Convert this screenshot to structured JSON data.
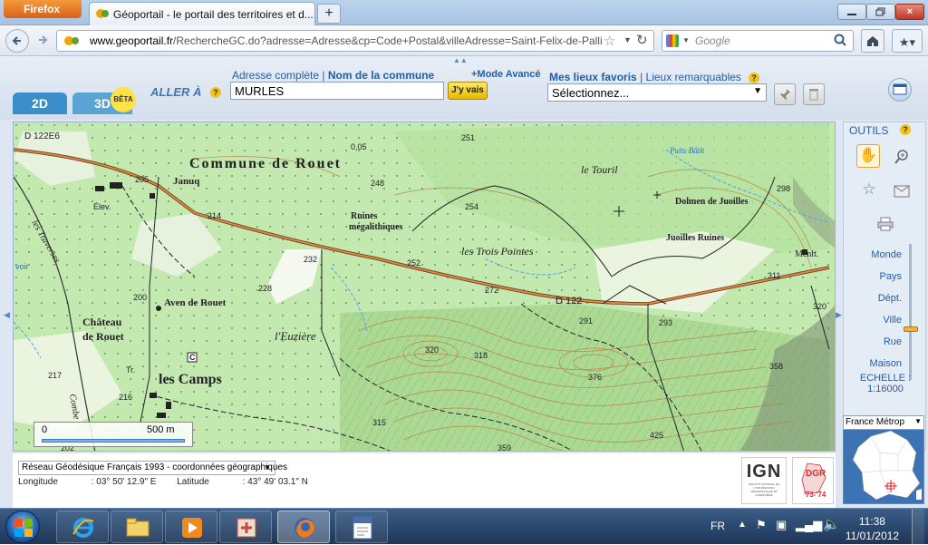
{
  "browser": {
    "app_button": "Firefox",
    "tab_title": "Géoportail - le portail des territoires et d...",
    "url_domain": "www.geoportail.fr",
    "url_path": "/RechercheGC.do?adresse=Adresse&cp=Code+Postal&villeAdresse=Saint-Felix-de-Palli",
    "search_placeholder": "Google",
    "new_tab": "+",
    "close_glyph": "×"
  },
  "geoportail": {
    "mode_tabs": [
      {
        "label": "2D"
      },
      {
        "label": "3D"
      }
    ],
    "beta_label": "BÊTA",
    "aller_a": "ALLER À",
    "help": "?",
    "address_link": "Adresse complète",
    "separator": "|",
    "commune_link": "Nom de la commune",
    "mode_avance": "+Mode Avancé",
    "address_value": "MURLES",
    "go_button": "J'y vais",
    "favoris_link": "Mes lieux favoris",
    "remarquables_link": "Lieux remarquables",
    "favoris_select": "Sélectionnez...",
    "outils_title": "OUTILS",
    "zoom_levels": [
      "Monde",
      "Pays",
      "Dépt.",
      "Ville",
      "Rue",
      "Maison"
    ],
    "zoom_level_fraction": 0.8,
    "echelle_label": "ECHELLE :",
    "echelle_value": "1:16000",
    "minimap_select": "France Métrop",
    "projection": "Réseau Géodésique Français 1993 - coordonnées géographiques",
    "longitude_label": "Longitude",
    "longitude_value": ": 03° 50' 12.9\" E",
    "latitude_label": "Latitude",
    "latitude_value": ": 43° 49' 03.1\" N",
    "scalebar_start": "0",
    "scalebar_end": "500 m",
    "ign_logo": "IGN",
    "ign_subtitle": "INSTITUT NATIONAL DE L'INFORMATION GÉOGRAPHIQUE ET FORESTIÈRE",
    "dgr_logo": "DGR",
    "dgr_year": "'73-'74"
  },
  "map_labels": {
    "commune": "Commune de Rouet",
    "janeq": "Januq",
    "elev": "Élev.",
    "ruines": "Ruines",
    "megalithiques": "mégalithiques",
    "trois_pointes": "les Trois Pointes",
    "touril": "le Touril",
    "puits": "Puits Bâtit",
    "dolmen": "Dolmen de Juoilles",
    "juoilles_ruines": "Juoilles Ruines",
    "menh": "Menh.",
    "aven": "Aven de Rouet",
    "chateau1": "Château",
    "chateau2": "de Rouet",
    "euziere": "l'Euzière",
    "les_camps": "les Camps",
    "d122e6": "D 122E6",
    "d122": "D 122",
    "traverses": "les Traverses",
    "tr": "Tr.",
    "c": "C",
    "voir": "voir",
    "combe": "Combe",
    "alt_005": "0,05",
    "alt_251": "251",
    "alt_205": "205",
    "alt_214": "214",
    "alt_248": "248",
    "alt_254": "254",
    "alt_232": "232",
    "alt_252": "252",
    "alt_228": "228",
    "alt_272": "272",
    "alt_291": "291",
    "alt_293": "293",
    "alt_311": "311",
    "alt_298": "298",
    "alt_320a": "320",
    "alt_320b": "320",
    "alt_318": "318",
    "alt_376": "376",
    "alt_358": "358",
    "alt_200": "200",
    "alt_217": "217",
    "alt_216": "216",
    "alt_315": "315",
    "alt_359": "359",
    "alt_425": "425",
    "alt_202": "202"
  },
  "taskbar": {
    "lang": "FR",
    "time": "11:38",
    "date": "11/01/2012"
  }
}
